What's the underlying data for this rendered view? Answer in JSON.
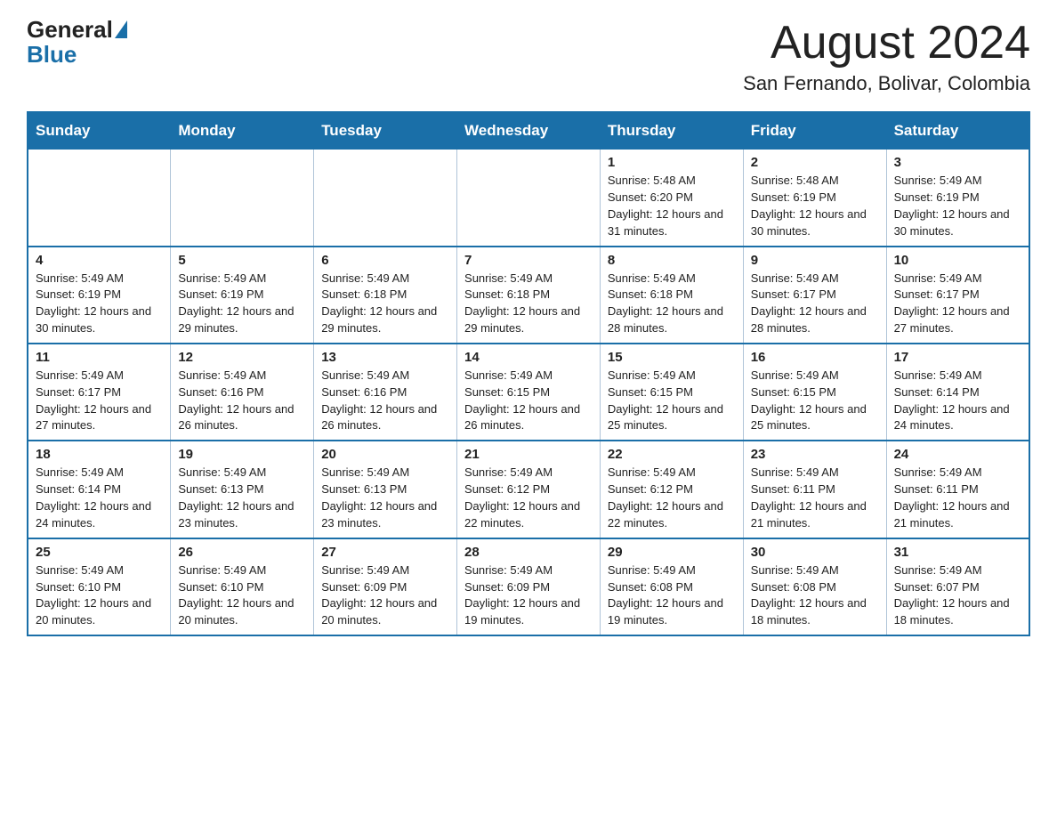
{
  "logo": {
    "general": "General",
    "blue": "Blue"
  },
  "header": {
    "month_title": "August 2024",
    "location": "San Fernando, Bolivar, Colombia"
  },
  "days_of_week": [
    "Sunday",
    "Monday",
    "Tuesday",
    "Wednesday",
    "Thursday",
    "Friday",
    "Saturday"
  ],
  "weeks": [
    [
      {
        "day": "",
        "sunrise": "",
        "sunset": "",
        "daylight": ""
      },
      {
        "day": "",
        "sunrise": "",
        "sunset": "",
        "daylight": ""
      },
      {
        "day": "",
        "sunrise": "",
        "sunset": "",
        "daylight": ""
      },
      {
        "day": "",
        "sunrise": "",
        "sunset": "",
        "daylight": ""
      },
      {
        "day": "1",
        "sunrise": "Sunrise: 5:48 AM",
        "sunset": "Sunset: 6:20 PM",
        "daylight": "Daylight: 12 hours and 31 minutes."
      },
      {
        "day": "2",
        "sunrise": "Sunrise: 5:48 AM",
        "sunset": "Sunset: 6:19 PM",
        "daylight": "Daylight: 12 hours and 30 minutes."
      },
      {
        "day": "3",
        "sunrise": "Sunrise: 5:49 AM",
        "sunset": "Sunset: 6:19 PM",
        "daylight": "Daylight: 12 hours and 30 minutes."
      }
    ],
    [
      {
        "day": "4",
        "sunrise": "Sunrise: 5:49 AM",
        "sunset": "Sunset: 6:19 PM",
        "daylight": "Daylight: 12 hours and 30 minutes."
      },
      {
        "day": "5",
        "sunrise": "Sunrise: 5:49 AM",
        "sunset": "Sunset: 6:19 PM",
        "daylight": "Daylight: 12 hours and 29 minutes."
      },
      {
        "day": "6",
        "sunrise": "Sunrise: 5:49 AM",
        "sunset": "Sunset: 6:18 PM",
        "daylight": "Daylight: 12 hours and 29 minutes."
      },
      {
        "day": "7",
        "sunrise": "Sunrise: 5:49 AM",
        "sunset": "Sunset: 6:18 PM",
        "daylight": "Daylight: 12 hours and 29 minutes."
      },
      {
        "day": "8",
        "sunrise": "Sunrise: 5:49 AM",
        "sunset": "Sunset: 6:18 PM",
        "daylight": "Daylight: 12 hours and 28 minutes."
      },
      {
        "day": "9",
        "sunrise": "Sunrise: 5:49 AM",
        "sunset": "Sunset: 6:17 PM",
        "daylight": "Daylight: 12 hours and 28 minutes."
      },
      {
        "day": "10",
        "sunrise": "Sunrise: 5:49 AM",
        "sunset": "Sunset: 6:17 PM",
        "daylight": "Daylight: 12 hours and 27 minutes."
      }
    ],
    [
      {
        "day": "11",
        "sunrise": "Sunrise: 5:49 AM",
        "sunset": "Sunset: 6:17 PM",
        "daylight": "Daylight: 12 hours and 27 minutes."
      },
      {
        "day": "12",
        "sunrise": "Sunrise: 5:49 AM",
        "sunset": "Sunset: 6:16 PM",
        "daylight": "Daylight: 12 hours and 26 minutes."
      },
      {
        "day": "13",
        "sunrise": "Sunrise: 5:49 AM",
        "sunset": "Sunset: 6:16 PM",
        "daylight": "Daylight: 12 hours and 26 minutes."
      },
      {
        "day": "14",
        "sunrise": "Sunrise: 5:49 AM",
        "sunset": "Sunset: 6:15 PM",
        "daylight": "Daylight: 12 hours and 26 minutes."
      },
      {
        "day": "15",
        "sunrise": "Sunrise: 5:49 AM",
        "sunset": "Sunset: 6:15 PM",
        "daylight": "Daylight: 12 hours and 25 minutes."
      },
      {
        "day": "16",
        "sunrise": "Sunrise: 5:49 AM",
        "sunset": "Sunset: 6:15 PM",
        "daylight": "Daylight: 12 hours and 25 minutes."
      },
      {
        "day": "17",
        "sunrise": "Sunrise: 5:49 AM",
        "sunset": "Sunset: 6:14 PM",
        "daylight": "Daylight: 12 hours and 24 minutes."
      }
    ],
    [
      {
        "day": "18",
        "sunrise": "Sunrise: 5:49 AM",
        "sunset": "Sunset: 6:14 PM",
        "daylight": "Daylight: 12 hours and 24 minutes."
      },
      {
        "day": "19",
        "sunrise": "Sunrise: 5:49 AM",
        "sunset": "Sunset: 6:13 PM",
        "daylight": "Daylight: 12 hours and 23 minutes."
      },
      {
        "day": "20",
        "sunrise": "Sunrise: 5:49 AM",
        "sunset": "Sunset: 6:13 PM",
        "daylight": "Daylight: 12 hours and 23 minutes."
      },
      {
        "day": "21",
        "sunrise": "Sunrise: 5:49 AM",
        "sunset": "Sunset: 6:12 PM",
        "daylight": "Daylight: 12 hours and 22 minutes."
      },
      {
        "day": "22",
        "sunrise": "Sunrise: 5:49 AM",
        "sunset": "Sunset: 6:12 PM",
        "daylight": "Daylight: 12 hours and 22 minutes."
      },
      {
        "day": "23",
        "sunrise": "Sunrise: 5:49 AM",
        "sunset": "Sunset: 6:11 PM",
        "daylight": "Daylight: 12 hours and 21 minutes."
      },
      {
        "day": "24",
        "sunrise": "Sunrise: 5:49 AM",
        "sunset": "Sunset: 6:11 PM",
        "daylight": "Daylight: 12 hours and 21 minutes."
      }
    ],
    [
      {
        "day": "25",
        "sunrise": "Sunrise: 5:49 AM",
        "sunset": "Sunset: 6:10 PM",
        "daylight": "Daylight: 12 hours and 20 minutes."
      },
      {
        "day": "26",
        "sunrise": "Sunrise: 5:49 AM",
        "sunset": "Sunset: 6:10 PM",
        "daylight": "Daylight: 12 hours and 20 minutes."
      },
      {
        "day": "27",
        "sunrise": "Sunrise: 5:49 AM",
        "sunset": "Sunset: 6:09 PM",
        "daylight": "Daylight: 12 hours and 20 minutes."
      },
      {
        "day": "28",
        "sunrise": "Sunrise: 5:49 AM",
        "sunset": "Sunset: 6:09 PM",
        "daylight": "Daylight: 12 hours and 19 minutes."
      },
      {
        "day": "29",
        "sunrise": "Sunrise: 5:49 AM",
        "sunset": "Sunset: 6:08 PM",
        "daylight": "Daylight: 12 hours and 19 minutes."
      },
      {
        "day": "30",
        "sunrise": "Sunrise: 5:49 AM",
        "sunset": "Sunset: 6:08 PM",
        "daylight": "Daylight: 12 hours and 18 minutes."
      },
      {
        "day": "31",
        "sunrise": "Sunrise: 5:49 AM",
        "sunset": "Sunset: 6:07 PM",
        "daylight": "Daylight: 12 hours and 18 minutes."
      }
    ]
  ]
}
